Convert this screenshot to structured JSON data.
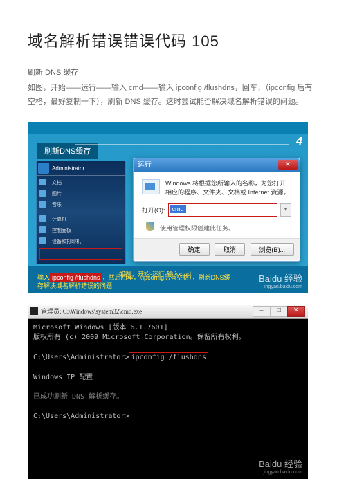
{
  "title": "域名解析错误错误代码 105",
  "subtitle": "刷新 DNS 缓存",
  "body": "如图，开始——运行——输入 cmd——输入 ipconfig   /flushdns，回车，（ipconfig 后有空格，最好复制一下），刷新 DNS 缓存。这时尝试能否解决域名解析错误的问题。",
  "fig1": {
    "tab": "刷新DNS缓存",
    "step": "4",
    "desktop": {
      "user": "Administrator",
      "items": [
        "文档",
        "图片",
        "音乐",
        "计算机",
        "控制面板",
        "设备和打印机"
      ]
    },
    "dialog": {
      "title": "运行",
      "close": "✕",
      "desc": "Windows 将根据您所输入的名称，为您打开相应的程序、文件夹、文档或 Internet 资源。",
      "label": "打开(O):",
      "value": "cmd",
      "dropdown_glyph": "▾",
      "admin": "使用管理权限创建此任务。",
      "ok": "确定",
      "cancel": "取消",
      "browse": "浏览(B)..."
    },
    "cap1": "如图，开始-运行-输入cmd,",
    "cap2_prefix": "输入",
    "cap2_hl": "ipconfig /flushdns",
    "cap2_suffix": "，然后回车，（ipconfig后有空格），刷新DNS缓存解决域名解析错误的问题",
    "watermark": "Baidu 经验",
    "watermark_sub": "jingyan.baidu.com"
  },
  "fig2": {
    "title": "管理员: C:\\Windows\\system32\\cmd.exe",
    "min": "–",
    "max": "□",
    "close": "✕",
    "line1a": "Microsoft Windows [版本 6.1.7601]",
    "line1b": "版权所有 (c) 2009 Microsoft Corporation。保留所有权利。",
    "prompt1": "C:\\Users\\Administrator>",
    "cmd": "ipconfig /flushdns",
    "line3": "Windows IP 配置",
    "line4": "已成功刷新 DNS 解析缓存。",
    "prompt2": "C:\\Users\\Administrator>",
    "watermark": "Baidu 经验",
    "watermark_sub": "jingyan.baidu.com"
  }
}
